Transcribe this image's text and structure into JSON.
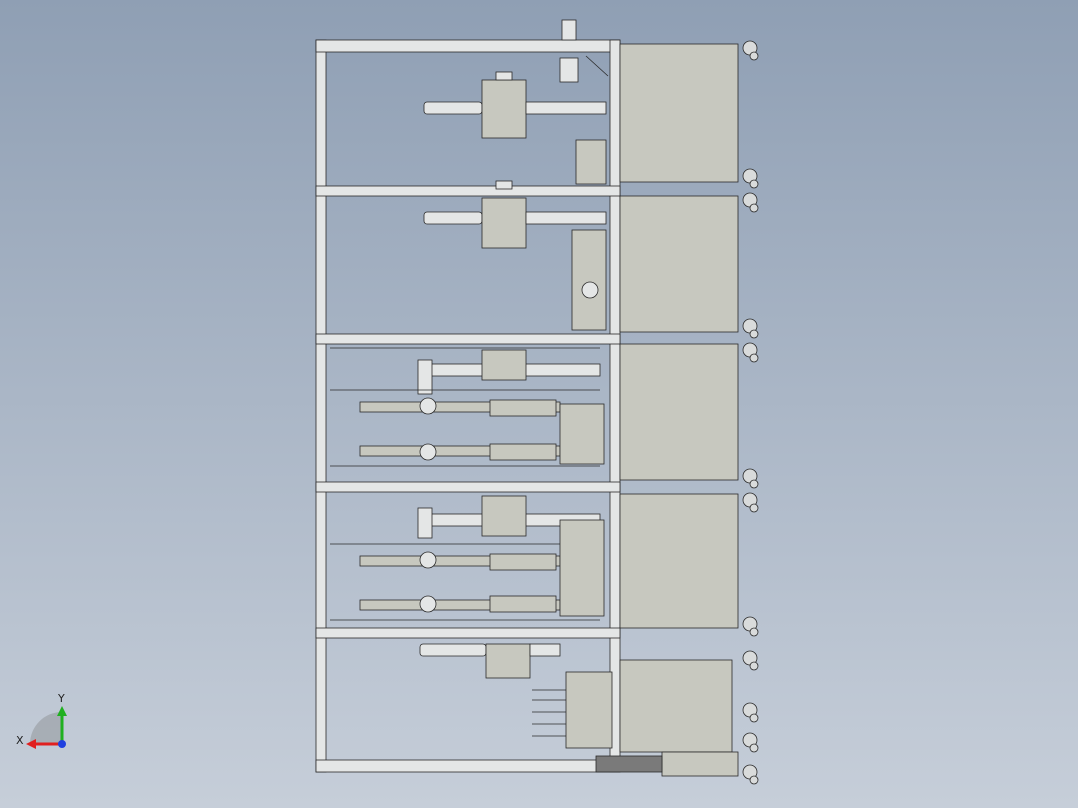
{
  "viewport": {
    "background_top": "#8f9fb4",
    "background_bottom": "#c6ced9",
    "frame_color": "#e4e6e6",
    "panel_color": "#c7c8bf",
    "line_color": "#2a2a2a"
  },
  "triad": {
    "x_label": "X",
    "y_label": "Y",
    "x_color": "#e02020",
    "y_color": "#20b020",
    "z_color": "#2040e0"
  }
}
